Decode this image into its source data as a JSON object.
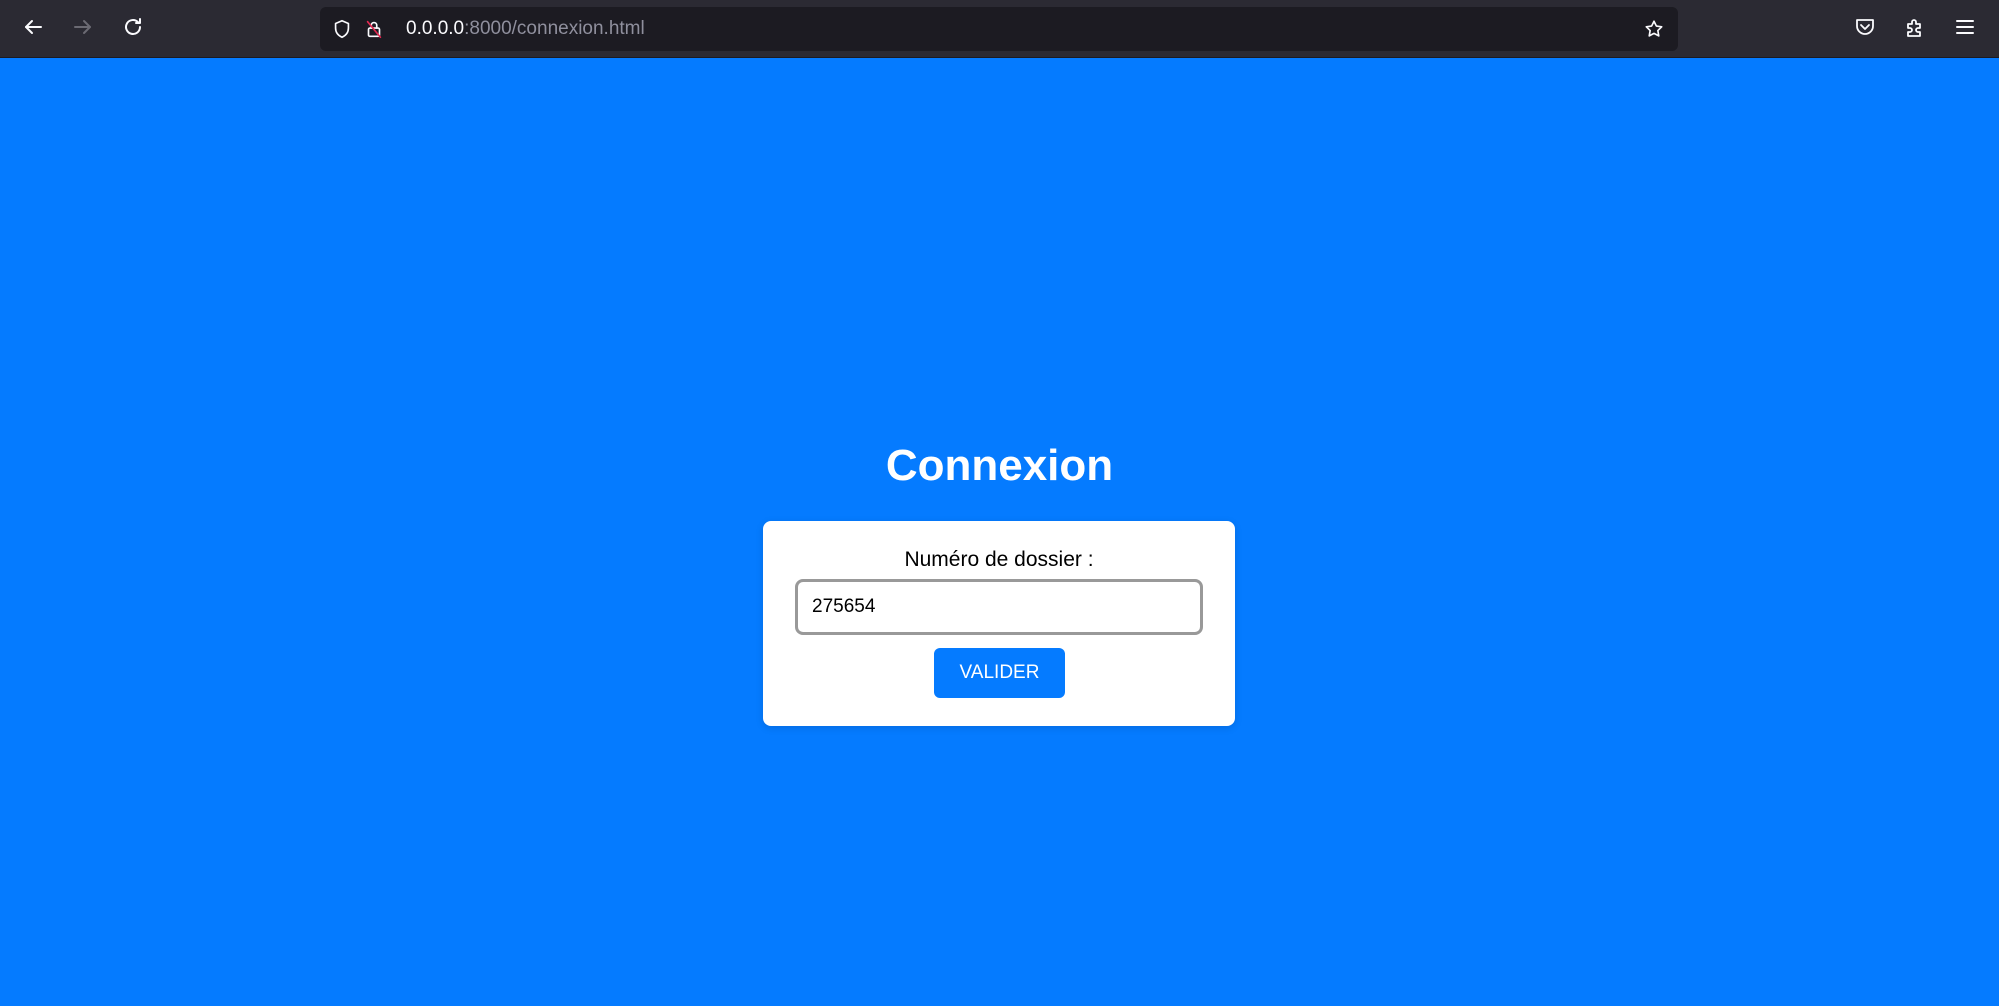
{
  "browser": {
    "url_host": "0.0.0.0",
    "url_rest": ":8000/connexion.html",
    "icons": {
      "back": "arrow-left-icon",
      "forward": "arrow-right-icon",
      "reload": "reload-icon",
      "shield": "shield-icon",
      "lock": "lock-insecure-icon",
      "bookmark": "star-icon",
      "pocket": "pocket-icon",
      "extensions": "puzzle-icon",
      "menu": "hamburger-menu-icon"
    }
  },
  "page": {
    "title": "Connexion",
    "form": {
      "label": "Numéro de dossier :",
      "input_value": "275654",
      "submit_label": "VALIDER"
    }
  },
  "colors": {
    "page_background": "#057bff",
    "button_background": "#057bff",
    "toolbar": "#2b2a33"
  }
}
